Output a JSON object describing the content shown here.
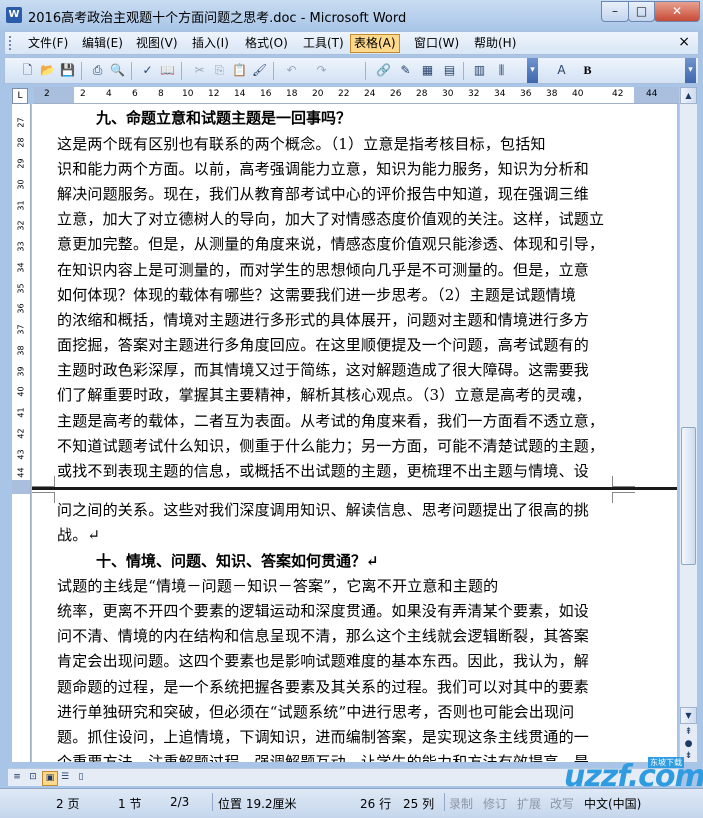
{
  "window": {
    "title": "2016高考政治主观题十个方面问题之思考.doc - Microsoft Word",
    "app_icon": "W"
  },
  "menu": {
    "items": [
      {
        "label": "文件(F)"
      },
      {
        "label": "编辑(E)"
      },
      {
        "label": "视图(V)"
      },
      {
        "label": "插入(I)"
      },
      {
        "label": "格式(O)"
      },
      {
        "label": "工具(T)"
      },
      {
        "label": "表格(A)"
      },
      {
        "label": "窗口(W)"
      },
      {
        "label": "帮助(H)"
      }
    ],
    "active": "表格(A)",
    "close_label": "×"
  },
  "toolbar": {
    "bold_label": "B"
  },
  "ruler": {
    "top_numbers": [
      "2",
      "2",
      "4",
      "6",
      "8",
      "10",
      "12",
      "14",
      "16",
      "18",
      "20",
      "22",
      "24",
      "26",
      "28",
      "30",
      "32",
      "34",
      "36",
      "38",
      "40",
      "42",
      "44"
    ],
    "left_numbers": [
      "27",
      "28",
      "29",
      "30",
      "31",
      "32",
      "33",
      "34",
      "35",
      "36",
      "37",
      "38",
      "39",
      "40",
      "41",
      "42",
      "43",
      "44"
    ]
  },
  "document": {
    "heading9": "九、命题立意和试题主题是一回事吗？",
    "para9_lines": [
      "      这是两个既有区别也有联系的两个概念。（1）立意是指考核目标，包括知",
      "识和能力两个方面。以前，高考强调能力立意，知识为能力服务，知识为分析和",
      "解决问题服务。现在，我们从教育部考试中心的评价报告中知道，现在强调三维",
      "立意，加大了对立德树人的导向，加大了对情感态度价值观的关注。这样，试题立",
      "意更加完整。但是，从测量的角度来说，情感态度价值观只能渗透、体现和引导，",
      "在知识内容上是可测量的，而对学生的思想倾向几乎是不可测量的。但是，立意",
      "如何体现？体现的载体有哪些？这需要我们进一步思考。（2）主题是试题情境",
      "的浓缩和概括，情境对主题进行多形式的具体展开，问题对主题和情境进行多方",
      "面挖掘，答案对主题进行多角度回应。在这里顺便提及一个问题，高考试题有的",
      "主题时政色彩深厚，而其情境又过于简练，这对解题造成了很大障碍。这需要我",
      "们了解重要时政，掌握其主要精神，解析其核心观点。（3）立意是高考的灵魂，",
      "主题是高考的载体，二者互为表面。从考试的角度来看，我们一方面看不透立意，",
      "不知道试题考试什么知识，侧重于什么能力；另一方面，可能不清楚试题的主题，",
      "或找不到表现主题的信息，或概括不出试题的主题，更梳理不出主题与情境、设"
    ],
    "para9_cont_lines": [
      "问之间的关系。这些对我们深度调用知识、解读信息、思考问题提出了很高的挑",
      "战。↵"
    ],
    "heading10": "十、情境、问题、知识、答案如何贯通？↵",
    "para10_lines": [
      "        试题的主线是“情境－问题－知识－答案”，它离不开立意和主题的",
      "统率，更离不开四个要素的逻辑运动和深度贯通。如果没有弄清某个要素，如设",
      "问不清、情境的内在结构和信息呈现不清，那么这个主线就会逻辑断裂，其答案",
      "肯定会出现问题。这四个要素也是影响试题难度的基本东西。因此，我认为，解",
      "题命题的过程，是一个系统把握各要素及其关系的过程。我们可以对其中的要素",
      "进行单独研究和突破，但必须在“试题系统”中进行思考，否则也可能会出现问",
      "题。抓住设问，上追情境，下调知识，进而编制答案，是实现这条主线贯通的一",
      "个重要方法。注重解题过程，强调解题互动，让学生的能力和方法有效提高。是"
    ]
  },
  "status": {
    "page": "2 页",
    "section": "1 节",
    "page_of": "2/3",
    "position": "位置 19.2厘米",
    "line": "26 行",
    "column": "25 列",
    "rec": "录制",
    "trk": "修订",
    "ext": "扩展",
    "ovr": "改写",
    "language": "中文(中国)"
  },
  "watermark": {
    "brand": "uzzf.com",
    "tag": "东坡下载"
  }
}
